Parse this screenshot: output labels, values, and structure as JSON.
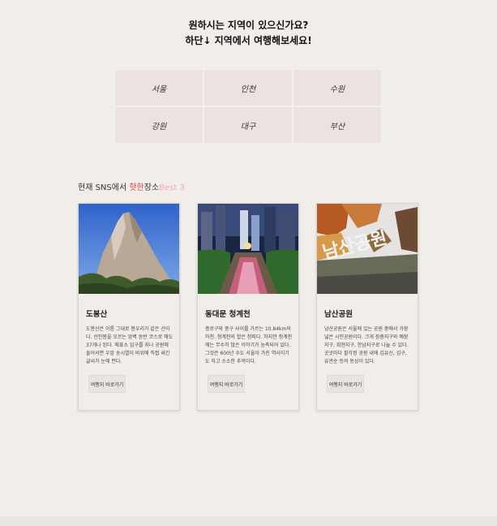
{
  "hero": {
    "line1": "원하시는 지역이 있으신가요?",
    "line2": "하단↓ 지역에서 여행해보세요!"
  },
  "regions": [
    "서울",
    "인천",
    "수원",
    "강원",
    "대구",
    "부산"
  ],
  "section": {
    "prefix": "현재 SNS에서 ",
    "hot": "핫한",
    "middle": "장소",
    "best": "Best 3"
  },
  "cards": [
    {
      "title": "도봉산",
      "desc": "도봉산은 이름 그대로 봉우리가 같은 산이다. 선인봉을 오르는 암벽 등반 코스로 해도 37개나 된다. 매표소 입구를 지나 공원에 들어서면 우암 송시열이 바위에 직접 새긴 글씨가 눈에 띈다.",
      "button": "여행지 바로가기"
    },
    {
      "title": "동대문 청계천",
      "desc": "종로구와 중구 사이를 가르는 10.84km의 하천. 청계천의 합은 청피다. 하지만 청계천에는 무수히 많은 이야기가 농축되어 있다. 그것은 600년 수도 서울이 가진 역사이기도 하고 소소한 추억이다.",
      "button": "여행지 바로가기"
    },
    {
      "title": "남산공원",
      "desc": "남산공원은 서울에 있는 공원 중에서 가장 넓은 시민공원이다. 크게 장충지구와 예장지구, 회현지구, 한남지구로 나눌 수 있다. 곳곳마다 팔각정 공원 내에 김유신, 김구, 유관순 등의 동상이 있다.",
      "button": "여행지 바로가기"
    }
  ],
  "images": {
    "card1": "mountain-rock-photo",
    "card2": "cheonggyecheon-night-stream-photo",
    "card3": "namsan-park-sign-photo"
  },
  "colors": {
    "background": "#f1eeea",
    "region_cell": "#ece2e2",
    "hot": "#e83a3a",
    "best": "#f4aab0"
  }
}
